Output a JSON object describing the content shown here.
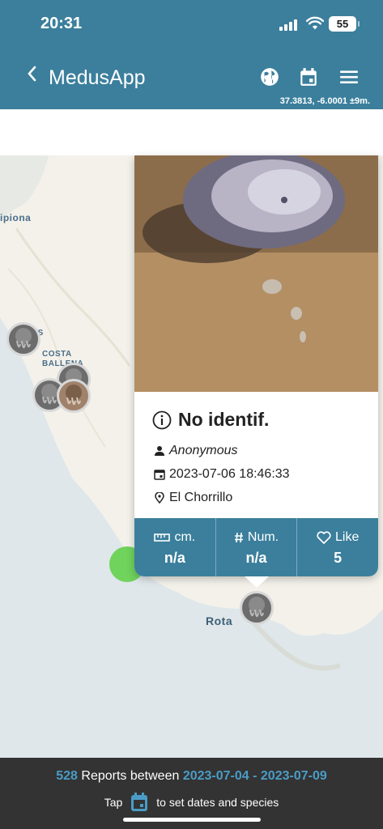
{
  "status_bar": {
    "time": "20:31",
    "battery": "55"
  },
  "header": {
    "title": "MedusApp",
    "coords": "37.3813, -6.0001 ±9m."
  },
  "map": {
    "labels": [
      "ipiona",
      "OPES\nRAS",
      "COSTA\nBALLENA",
      "Rota"
    ]
  },
  "popup": {
    "species": "No identif.",
    "user": "Anonymous",
    "datetime": "2023-07-06 18:46:33",
    "place": "El Chorrillo",
    "stats": [
      {
        "label": "cm.",
        "value": "n/a",
        "icon": "ruler-icon"
      },
      {
        "label": "Num.",
        "value": "n/a",
        "icon": "hash-icon"
      },
      {
        "label": "Like",
        "value": "5",
        "icon": "heart-icon"
      }
    ]
  },
  "footer": {
    "count": "528",
    "reports_between": "Reports between",
    "date_range": "2023-07-04 - 2023-07-09",
    "tap": "Tap",
    "tap_suffix": "to set dates and species"
  },
  "colors": {
    "primary": "#3b7f9c",
    "accent": "#4a9cc6",
    "footer_bg": "#333333",
    "green_dot": "#6fd35c"
  }
}
